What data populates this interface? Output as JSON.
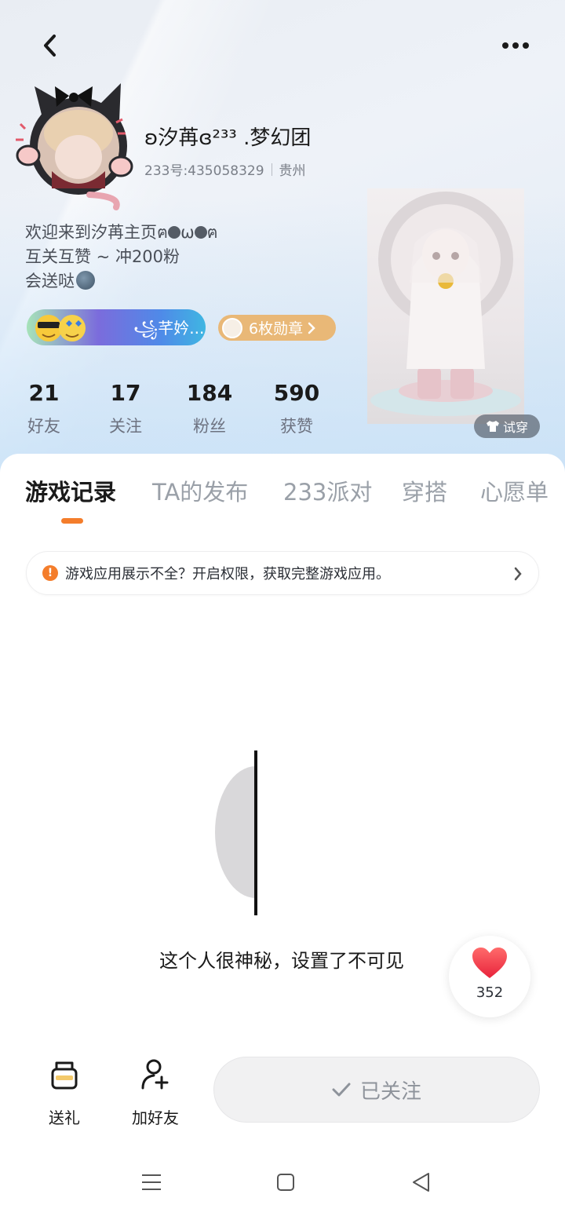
{
  "header": {
    "back_icon": "chevron-left-icon",
    "more_icon": "more-horizontal-icon"
  },
  "profile": {
    "username": "ʚ汐苒ɞ²³³ .梦幻团",
    "id_text": "233号:435058329",
    "location": "贵州",
    "bio_line1_text": "欢迎来到汐苒主页ฅ",
    "bio_line1_mid": "ω",
    "bio_line1_end": "ฅ",
    "bio_line2": "互关互赞 ~ 冲200粉",
    "bio_line3": "会送哒",
    "group_name": "꧁芊妗...",
    "medal_label": "6枚勋章"
  },
  "stats": [
    {
      "value": "21",
      "label": "好友"
    },
    {
      "value": "17",
      "label": "关注"
    },
    {
      "value": "184",
      "label": "粉丝"
    },
    {
      "value": "590",
      "label": "获赞"
    }
  ],
  "figure": {
    "tryon_label": "试穿"
  },
  "tabs": [
    {
      "label": "游戏记录",
      "active": true
    },
    {
      "label": "TA的发布",
      "active": false
    },
    {
      "label": "233派对",
      "active": false
    },
    {
      "label": "穿搭",
      "active": false
    },
    {
      "label": "心愿单",
      "active": false
    }
  ],
  "notice": {
    "text": "游戏应用展示不全？开启权限，获取完整游戏应用。"
  },
  "empty_state": {
    "text": "这个人很神秘，设置了不可见"
  },
  "like": {
    "count": "352"
  },
  "bottom_bar": {
    "gift_label": "送礼",
    "add_friend_label": "加好友",
    "follow_label": "已关注"
  },
  "colors": {
    "accent": "#f47d2b",
    "medal": "#e9b877",
    "like_heart": "#f23b4a"
  }
}
